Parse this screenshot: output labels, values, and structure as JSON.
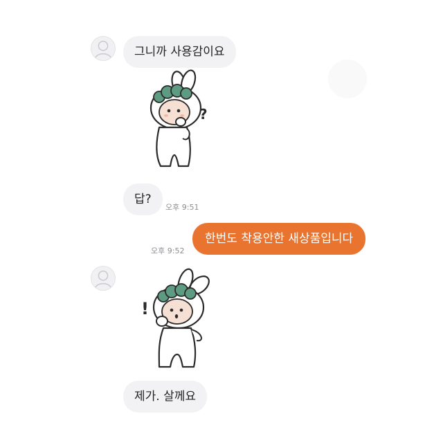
{
  "messages": [
    {
      "type": "text",
      "direction": "incoming",
      "text": "그니까 사용감이요"
    },
    {
      "type": "sticker",
      "direction": "incoming",
      "sticker": "bunny-thinking-question"
    },
    {
      "type": "text",
      "direction": "incoming",
      "text": "답?",
      "time": "오후 9:51"
    },
    {
      "type": "text",
      "direction": "outgoing",
      "text": "한번도 착용안한 새상품입니다",
      "time": "오후 9:52"
    },
    {
      "type": "sticker",
      "direction": "incoming",
      "sticker": "bunny-surprised-exclaim"
    },
    {
      "type": "text",
      "direction": "incoming",
      "text": "제가. 살께요"
    }
  ],
  "colors": {
    "outgoing_bubble": "#e8742f",
    "incoming_bubble": "#f2f2f4",
    "sticker_leaf": "#5d9c83",
    "timestamp": "#8d8d92"
  },
  "icons": {
    "avatar": "default-profile-icon",
    "sticker_question_mark": "?",
    "sticker_exclaim_mark": "!"
  }
}
